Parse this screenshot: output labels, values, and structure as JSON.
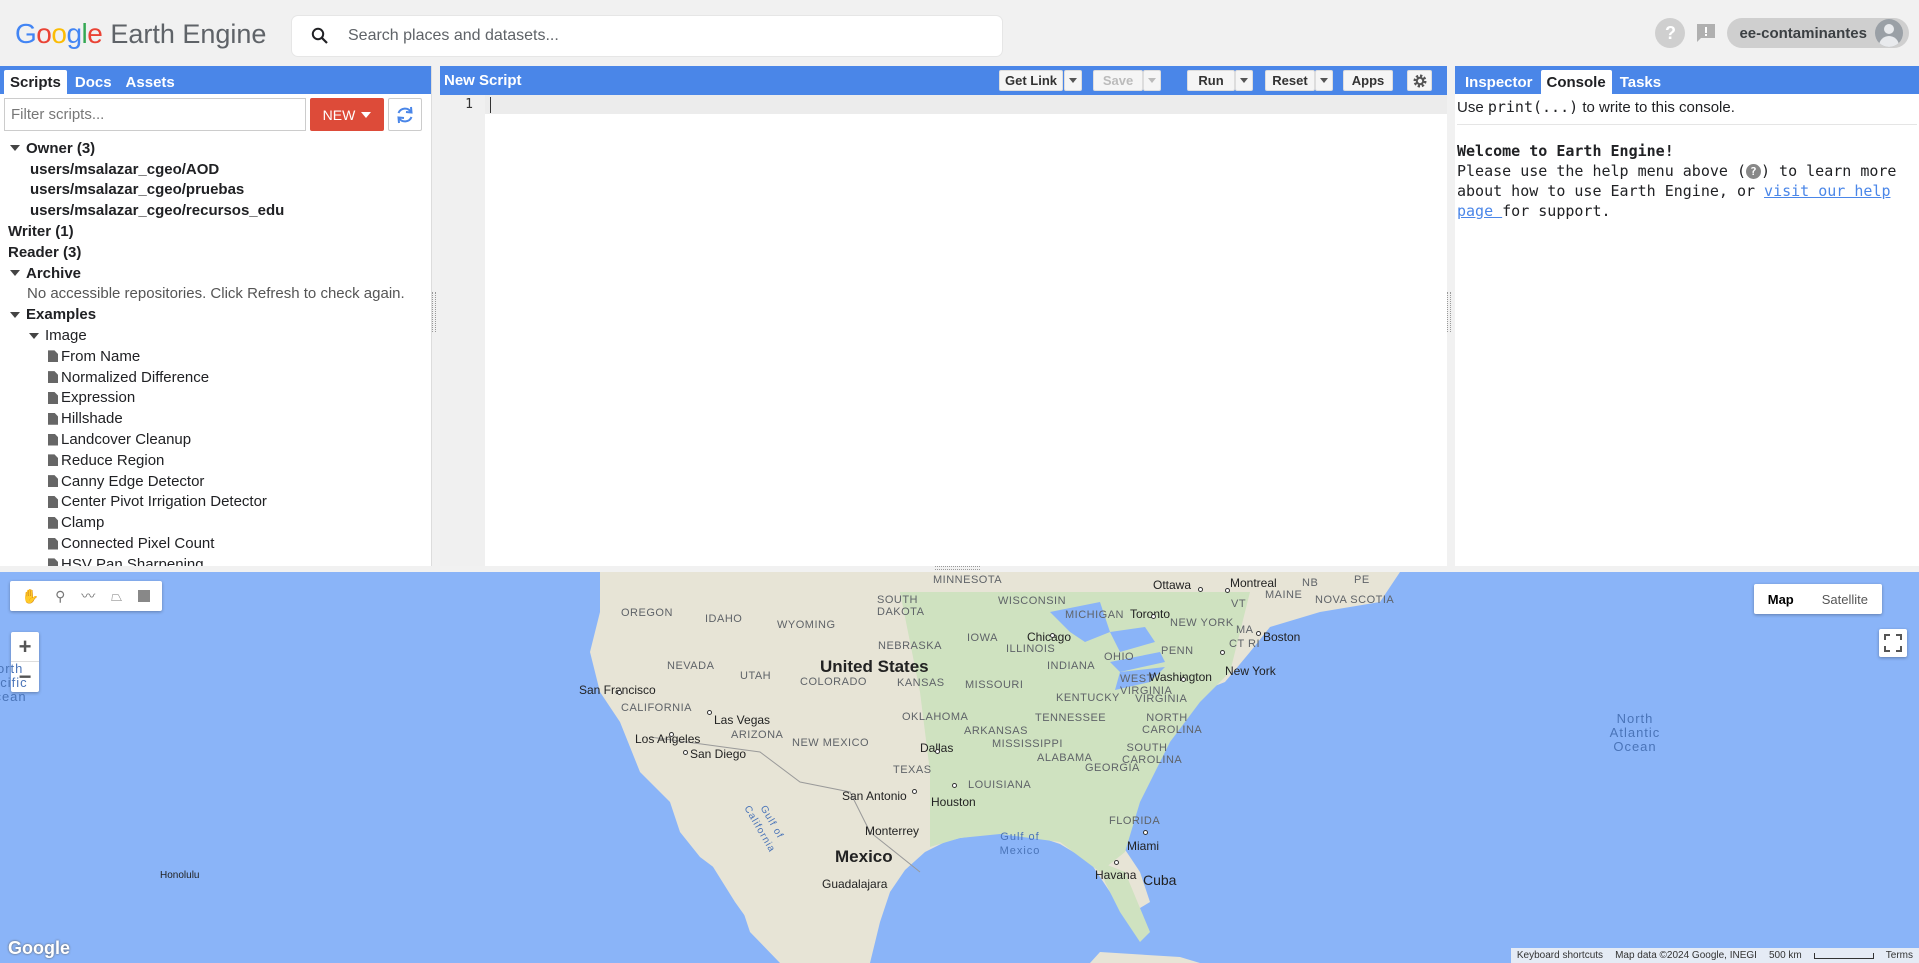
{
  "header": {
    "logo_google": "Google",
    "logo_product": "Earth Engine",
    "search_placeholder": "Search places and datasets...",
    "help_label": "?",
    "account": "ee-contaminantes"
  },
  "left_panel": {
    "tabs": [
      "Scripts",
      "Docs",
      "Assets"
    ],
    "filter_placeholder": "Filter scripts...",
    "new_label": "NEW",
    "tree": {
      "owner": "Owner (3)",
      "owner_items": [
        "users/msalazar_cgeo/AOD",
        "users/msalazar_cgeo/pruebas",
        "users/msalazar_cgeo/recursos_edu"
      ],
      "writer": "Writer (1)",
      "reader": "Reader (3)",
      "archive": "Archive",
      "archive_msg": "No accessible repositories. Click Refresh to check again.",
      "examples": "Examples",
      "image": "Image",
      "image_items": [
        "From Name",
        "Normalized Difference",
        "Expression",
        "Hillshade",
        "Landcover Cleanup",
        "Reduce Region",
        "Canny Edge Detector",
        "Center Pivot Irrigation Detector",
        "Clamp",
        "Connected Pixel Count",
        "HSV Pan Sharpening"
      ]
    }
  },
  "editor": {
    "title": "New Script",
    "get_link": "Get Link",
    "save": "Save",
    "run": "Run",
    "reset": "Reset",
    "apps": "Apps",
    "line_number": "1"
  },
  "right_panel": {
    "tabs": [
      "Inspector",
      "Console",
      "Tasks"
    ],
    "hint_pre": "Use ",
    "hint_code": "print(...)",
    "hint_post": " to write to this console.",
    "welcome_title": "Welcome to Earth Engine!",
    "welcome_line1": "Please use the help menu above (",
    "welcome_line1b": ") to learn more about how to use Earth Engine, or ",
    "welcome_link": "visit our help page ",
    "welcome_end": "for support."
  },
  "map": {
    "map_type": [
      "Map",
      "Satellite"
    ],
    "zoom_in": "+",
    "zoom_out": "−",
    "logo": "Google",
    "attribution": [
      "Keyboard shortcuts",
      "Map data ©2024 Google, INEGI",
      "500 km",
      "Terms"
    ],
    "labels": {
      "country_us": "United States",
      "country_mx": "Mexico",
      "states": [
        "OREGON",
        "IDAHO",
        "WYOMING",
        "SOUTH DAKOTA",
        "MINNESOTA",
        "WISCONSIN",
        "MICHIGAN",
        "NEBRASKA",
        "IOWA",
        "ILLINOIS",
        "OHIO",
        "NEVADA",
        "UTAH",
        "COLORADO",
        "KANSAS",
        "MISSOURI",
        "INDIANA",
        "CALIFORNIA",
        "ARIZONA",
        "NEW MEXICO",
        "OKLAHOMA",
        "ARKANSAS",
        "TENNESSEE",
        "KENTUCKY",
        "WEST VIRGINIA",
        "VIRGINIA",
        "PENN",
        "NEW YORK",
        "MAINE",
        "NOVA SCOTIA",
        "VT",
        "MA",
        "CT",
        "RI",
        "NORTH CAROLINA",
        "SOUTH CAROLINA",
        "MISSISSIPPI",
        "ALABAMA",
        "GEORGIA",
        "TEXAS",
        "LOUISIANA",
        "FLORIDA",
        "NB",
        "PE"
      ],
      "cities": [
        "Ottawa",
        "Montreal",
        "Toronto",
        "Boston",
        "Chicago",
        "Washington",
        "New York",
        "San Francisco",
        "Las Vegas",
        "Los Angeles",
        "San Diego",
        "Dallas",
        "San Antonio",
        "Houston",
        "Monterrey",
        "Miami",
        "Havana",
        "Cuba",
        "Guadalajara",
        "Honolulu"
      ],
      "oceans": [
        "North Pacific Ocean",
        "North Atlantic Ocean",
        "Gulf of Mexico",
        "Gulf of California"
      ]
    }
  }
}
